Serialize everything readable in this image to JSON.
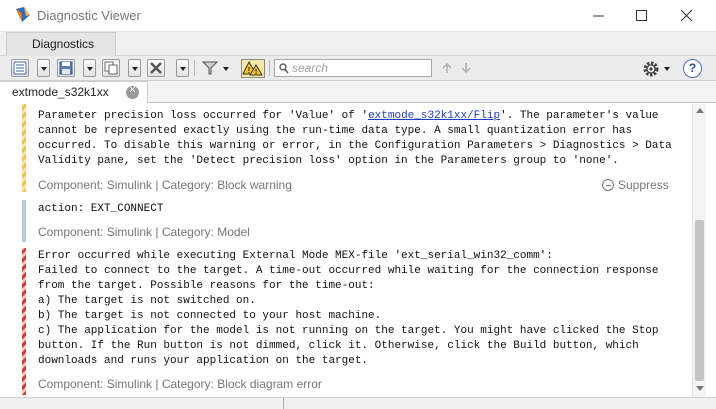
{
  "window": {
    "title": "Diagnostic Viewer",
    "controls": [
      "minimize-icon",
      "maximize-icon",
      "close-icon"
    ]
  },
  "tabs": [
    {
      "label": "Diagnostics"
    }
  ],
  "toolbar": {
    "search_placeholder": "search",
    "icons": [
      "list-view-icon",
      "save-icon",
      "copy-icon",
      "clear-icon",
      "filter-icon",
      "warning-toggle-icon",
      "up-arrow-icon",
      "down-arrow-icon",
      "gear-icon",
      "help-icon"
    ],
    "help_label": "?"
  },
  "document_tab": {
    "label": "extmode_s32k1xx"
  },
  "messages": [
    {
      "type": "warning",
      "lines": [
        "Parameter precision loss occurred for 'Value' of '",
        "extmode_s32k1xx/Flip",
        "'. The parameter's value",
        "cannot be represented exactly using the run-time data type. A small quantization error has",
        "occurred. To disable this warning or error, in the Configuration Parameters > Diagnostics > Data",
        "Validity pane, set the 'Detect precision loss' option in the Parameters group to 'none'."
      ],
      "meta": "Component: Simulink | Category: Block warning",
      "suppress": "Suppress"
    },
    {
      "type": "info",
      "lines": [
        "action: EXT_CONNECT"
      ],
      "meta": "Component: Simulink | Category: Model"
    },
    {
      "type": "error",
      "lines": [
        "Error occurred while executing External Mode MEX-file 'ext_serial_win32_comm':",
        "Failed to connect to the target. A time-out occurred while waiting for the connection response",
        "from the target. Possible reasons for the time-out:",
        "a) The target is not switched on.",
        "b) The target is not connected to your host machine.",
        "c) The application for the model is not running on the target. You might have clicked the Stop",
        "button. If the Run button is not dimmed, click it. Otherwise, click the Build button, which",
        "downloads and runs your application on the target."
      ],
      "meta": "Component: Simulink | Category: Block diagram error"
    }
  ],
  "colors": {
    "warning": "#f2c14a",
    "info": "#b5c9dc",
    "error": "#d63a3a",
    "link": "#1a3fbf"
  }
}
